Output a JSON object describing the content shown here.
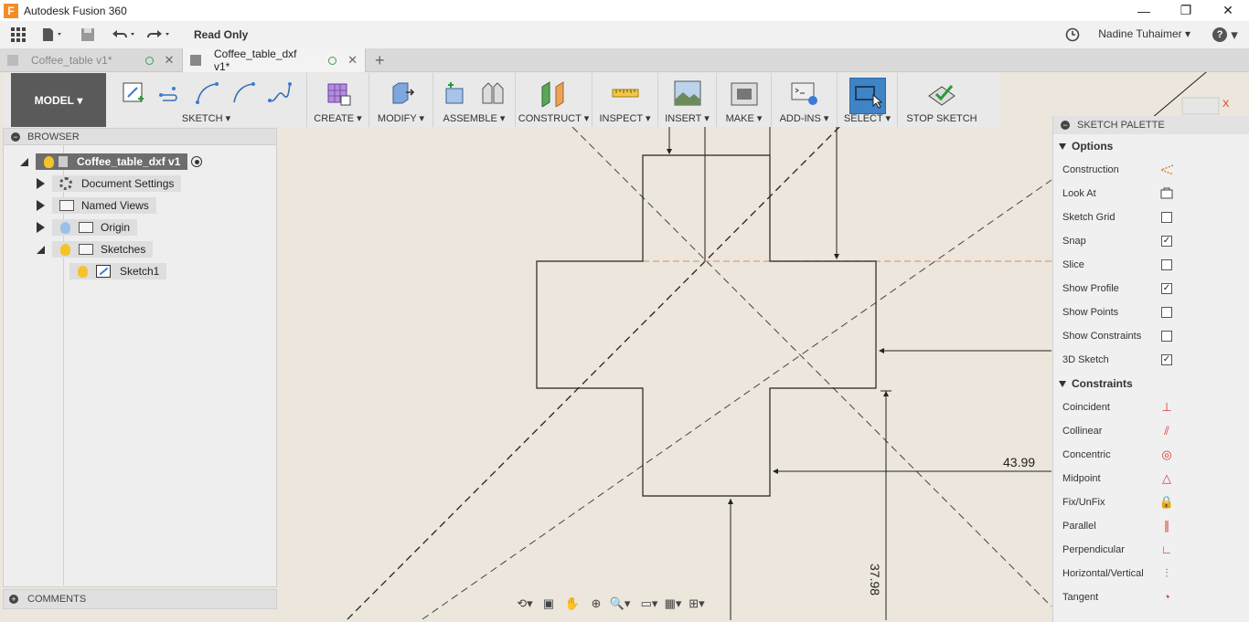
{
  "app": {
    "title": "Autodesk Fusion 360",
    "logo_letter": "F"
  },
  "window_controls": {
    "minimize": "—",
    "restore": "❐",
    "close": "✕"
  },
  "qat": {
    "read_only": "Read Only",
    "user_name": "Nadine Tuhaimer",
    "help": "?"
  },
  "tabs": [
    {
      "label": "Coffee_table v1*",
      "active": false
    },
    {
      "label": "Coffee_table_dxf v1*",
      "active": true
    }
  ],
  "ribbon": {
    "workspace": "MODEL",
    "groups": [
      "SKETCH",
      "CREATE",
      "MODIFY",
      "ASSEMBLE",
      "CONSTRUCT",
      "INSPECT",
      "INSERT",
      "MAKE",
      "ADD-INS",
      "SELECT",
      "STOP SKETCH"
    ]
  },
  "browser": {
    "title": "BROWSER",
    "root": "Coffee_table_dxf v1",
    "items": [
      "Document Settings",
      "Named Views",
      "Origin",
      "Sketches",
      "Sketch1"
    ]
  },
  "comments": {
    "title": "COMMENTS"
  },
  "canvas": {
    "dimensions": [
      "43.99",
      "37.98"
    ]
  },
  "palette": {
    "title": "SKETCH PALETTE",
    "options_title": "Options",
    "options": [
      {
        "label": "Construction",
        "checked": null
      },
      {
        "label": "Look At",
        "checked": null
      },
      {
        "label": "Sketch Grid",
        "checked": false
      },
      {
        "label": "Snap",
        "checked": true
      },
      {
        "label": "Slice",
        "checked": false
      },
      {
        "label": "Show Profile",
        "checked": true
      },
      {
        "label": "Show Points",
        "checked": false
      },
      {
        "label": "Show Constraints",
        "checked": false
      },
      {
        "label": "3D Sketch",
        "checked": true
      }
    ],
    "constraints_title": "Constraints",
    "constraints": [
      {
        "label": "Coincident",
        "icon": "⊥"
      },
      {
        "label": "Collinear",
        "icon": "⫽"
      },
      {
        "label": "Concentric",
        "icon": "◎"
      },
      {
        "label": "Midpoint",
        "icon": "△"
      },
      {
        "label": "Fix/UnFix",
        "icon": "🔒"
      },
      {
        "label": "Parallel",
        "icon": "∥"
      },
      {
        "label": "Perpendicular",
        "icon": "∟"
      },
      {
        "label": "Horizontal/Vertical",
        "icon": "⫶"
      },
      {
        "label": "Tangent",
        "icon": "◔"
      }
    ]
  },
  "colors": {
    "canvas": "#ece6dc",
    "select_active": "#3f84c5",
    "constraint_icon": "#d43a2f"
  }
}
